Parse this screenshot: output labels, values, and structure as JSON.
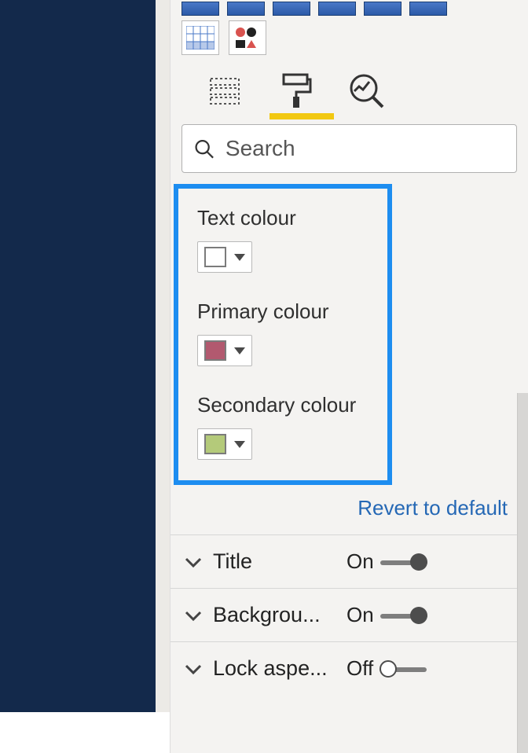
{
  "search": {
    "placeholder": "Search"
  },
  "colourFields": {
    "text": {
      "label": "Text colour",
      "swatch": "#ffffff"
    },
    "primary": {
      "label": "Primary colour",
      "swatch": "#b2596f"
    },
    "secondary": {
      "label": "Secondary colour",
      "swatch": "#b4ca7a"
    }
  },
  "links": {
    "revert": "Revert to default"
  },
  "accordions": {
    "title": {
      "label": "Title",
      "stateText": "On",
      "on": true
    },
    "background": {
      "label": "Backgrou...",
      "stateText": "On",
      "on": true
    },
    "lockAspect": {
      "label": "Lock aspe...",
      "stateText": "Off",
      "on": false
    }
  }
}
